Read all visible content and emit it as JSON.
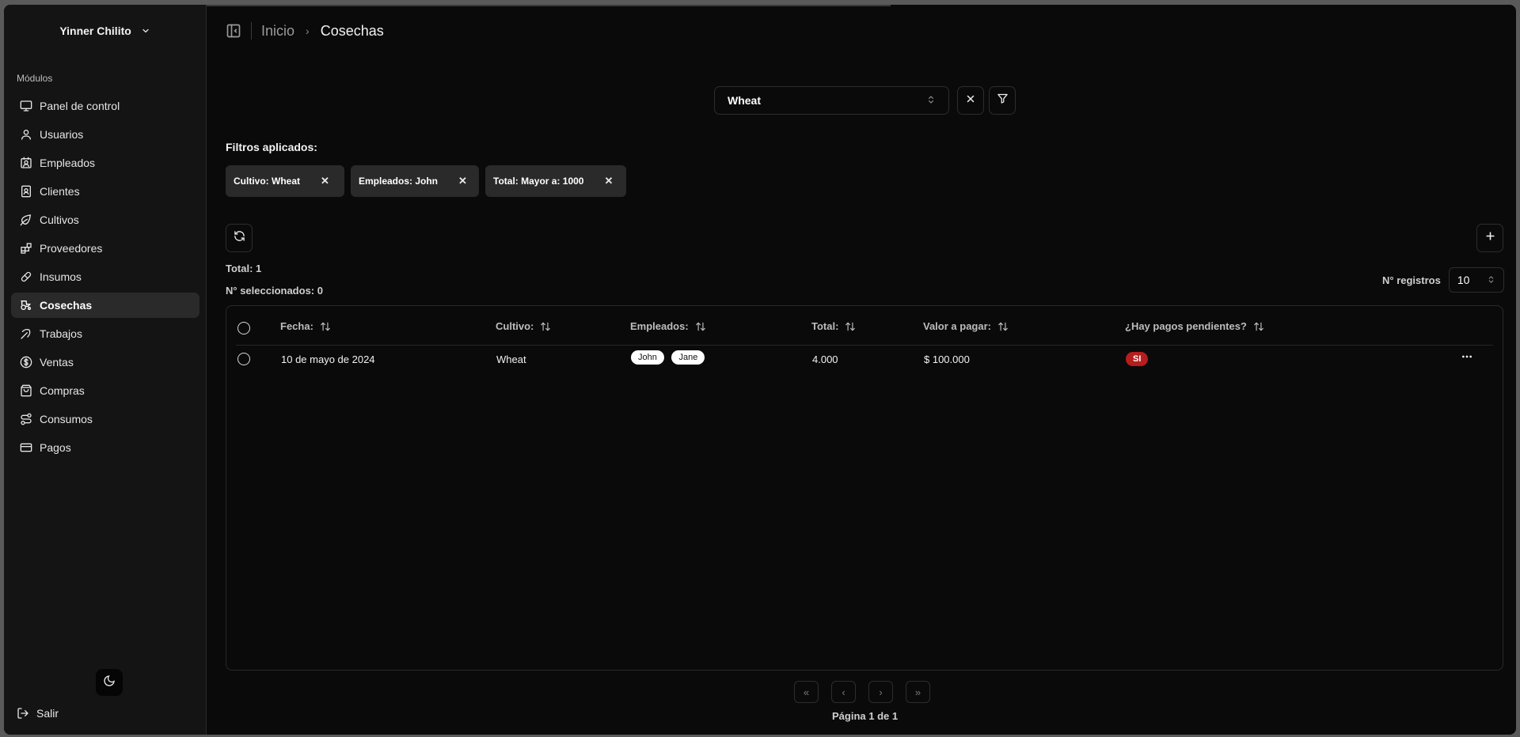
{
  "sidebar": {
    "user_name": "Yinner Chilito",
    "section_label": "Módulos",
    "items": [
      {
        "label": "Panel de control",
        "icon": "monitor-icon"
      },
      {
        "label": "Usuarios",
        "icon": "user-icon"
      },
      {
        "label": "Empleados",
        "icon": "contact-icon"
      },
      {
        "label": "Clientes",
        "icon": "contact-book-icon"
      },
      {
        "label": "Cultivos",
        "icon": "leaf-icon"
      },
      {
        "label": "Proveedores",
        "icon": "blocks-icon"
      },
      {
        "label": "Insumos",
        "icon": "pill-icon"
      },
      {
        "label": "Cosechas",
        "icon": "tractor-icon",
        "active": true
      },
      {
        "label": "Trabajos",
        "icon": "pickaxe-icon"
      },
      {
        "label": "Ventas",
        "icon": "dollar-circle-icon"
      },
      {
        "label": "Compras",
        "icon": "shopping-bag-icon"
      },
      {
        "label": "Consumos",
        "icon": "route-icon"
      },
      {
        "label": "Pagos",
        "icon": "credit-card-icon"
      }
    ],
    "logout_label": "Salir"
  },
  "breadcrumb": {
    "home": "Inicio",
    "current": "Cosechas"
  },
  "search": {
    "selected_value": "Wheat"
  },
  "filters": {
    "title": "Filtros aplicados:",
    "chips": [
      {
        "label": "Cultivo: Wheat"
      },
      {
        "label": "Empleados: John"
      },
      {
        "label": "Total: Mayor a: 1000"
      }
    ]
  },
  "summary": {
    "total": "Total: 1",
    "selected": "N° seleccionados: 0"
  },
  "records": {
    "label": "N° registros",
    "value": "10"
  },
  "table": {
    "headers": {
      "fecha": "Fecha:",
      "cultivo": "Cultivo:",
      "empleados": "Empleados:",
      "total": "Total:",
      "valor": "Valor a pagar:",
      "pendientes": "¿Hay pagos pendientes?"
    },
    "rows": [
      {
        "fecha": "10 de mayo de 2024",
        "cultivo": "Wheat",
        "empleados": [
          "John",
          "Jane"
        ],
        "total": "4.000",
        "valor": "$ 100.000",
        "pendientes": "SI"
      }
    ]
  },
  "pagination": {
    "info": "Página 1 de 1"
  },
  "colors": {
    "badge_red": "#b81d1d",
    "active_bg": "#2a2a2a"
  }
}
